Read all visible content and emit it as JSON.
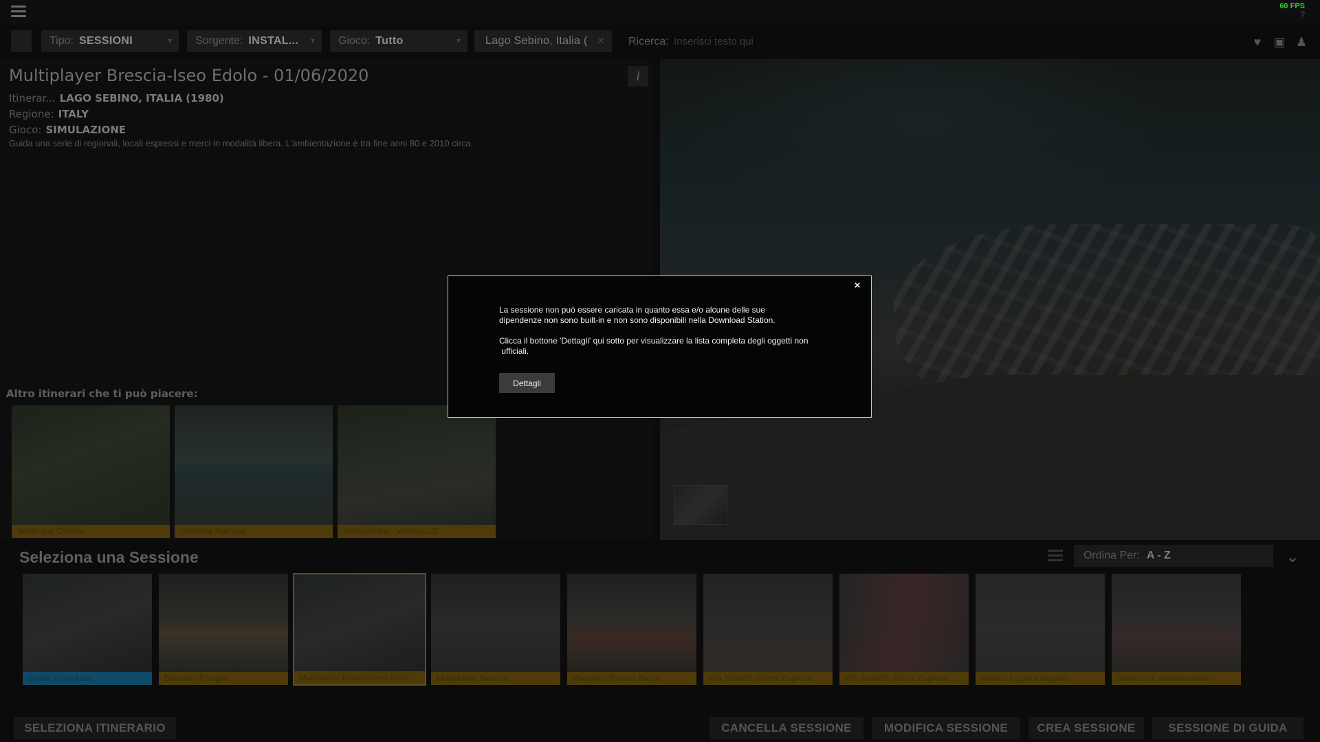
{
  "topbar": {
    "fps": "60 FPS",
    "help": "?"
  },
  "filters": {
    "tipo": {
      "label": "Tipo:",
      "value": "SESSIONI"
    },
    "sorgente": {
      "label": "Sorgente:",
      "value": "INSTAL..."
    },
    "gioco": {
      "label": "Gioco:",
      "value": "Tutto"
    },
    "route": {
      "value": "Lago Sebino, Italia  ("
    },
    "search": {
      "label": "Ricerca:",
      "placeholder": "Inserisci testo qui"
    }
  },
  "detail": {
    "title": "Multiplayer Brescia-Iseo Edolo - 01/06/2020",
    "itinerary": {
      "label": "Itinerar...",
      "value": "LAGO SEBINO, ITALIA  (1980)"
    },
    "region": {
      "label": "Regione:",
      "value": "ITALY"
    },
    "game": {
      "label": "Gioco:",
      "value": "SIMULAZIONE"
    },
    "description": "Guida una serie di regionali, locali espressi e merci in modalità libera. L'ambientazione è tra fine anni 80 e 2010 circa.",
    "info_label": "i",
    "also_label": "Altro itinerari che ti può piacere:",
    "recommendations": [
      {
        "label": "Settle and Carlisle"
      },
      {
        "label": "Shortline Railroad"
      },
      {
        "label": "Andrushivka - Vinnitsa UZ"
      }
    ]
  },
  "sessions": {
    "title": "Seleziona una Sessione",
    "sort": {
      "label": "Ordina Per:",
      "value": "A - Z"
    },
    "items": [
      {
        "label": "Guida Immediata"
      },
      {
        "label": "Brescia - Pisogne"
      },
      {
        "label": "Multiplayer Brescia-Iseo Edol..."
      },
      {
        "label": "Multiplayer Session"
      },
      {
        "label": "Pisogne - Rovato Borgo"
      },
      {
        "label": "Pro Trainz®: Orient Express"
      },
      {
        "label": "Pro Trainz®: Orient Express ..."
      },
      {
        "label": "Rovato freight transport"
      },
      {
        "label": "Servizio di manutenzione"
      }
    ]
  },
  "buttons": {
    "select_route": "SELEZIONA ITINERARIO",
    "delete": "CANCELLA SESSIONE",
    "edit": "MODIFICA SESSIONE",
    "create": "CREA SESSIONE",
    "drive": "SESSIONE DI GUIDA"
  },
  "modal": {
    "close": "×",
    "line1": "La sessione non può essere caricata in quanto essa e/o alcune delle sue",
    "line2": "dipendenze non sono built-in e non sono disponibili nella Download Station.",
    "line3": "Clicca il bottone 'Dettagli' qui sotto per visualizzare la lista completa degli oggetti non",
    "line4": " ufficiali.",
    "button": "Dettagli"
  }
}
